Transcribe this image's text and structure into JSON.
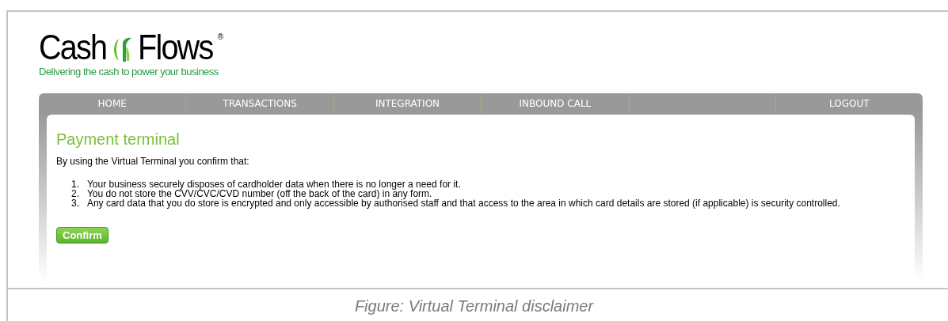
{
  "logo": {
    "left": "Cash",
    "right": "Flows",
    "mark": "®",
    "tagline": "Delivering the cash to power your business"
  },
  "nav": [
    {
      "kind": "link",
      "label": "HOME"
    },
    {
      "kind": "link",
      "label": "TRANSACTIONS"
    },
    {
      "kind": "link",
      "label": "INTEGRATION"
    },
    {
      "kind": "link",
      "label": "INBOUND CALL"
    },
    {
      "kind": "spacer"
    },
    {
      "kind": "link",
      "label": "LOGOUT"
    }
  ],
  "page": {
    "title": "Payment terminal",
    "intro": "By using the Virtual Terminal you confirm that:",
    "items": [
      {
        "number": "1.",
        "text": "Your business securely disposes of cardholder data when there is no longer a need for it."
      },
      {
        "number": "2.",
        "text": "You do not store the CVV/CVC/CVD number (off the back of the card) in any form."
      },
      {
        "number": "3.",
        "text": "Any card data that you do store is encrypted and only accessible by authorised staff and that access to the area in which card details are stored (if applicable) is security controlled."
      }
    ],
    "button": "Confirm"
  },
  "caption": "Figure: Virtual Terminal disclaimer"
}
